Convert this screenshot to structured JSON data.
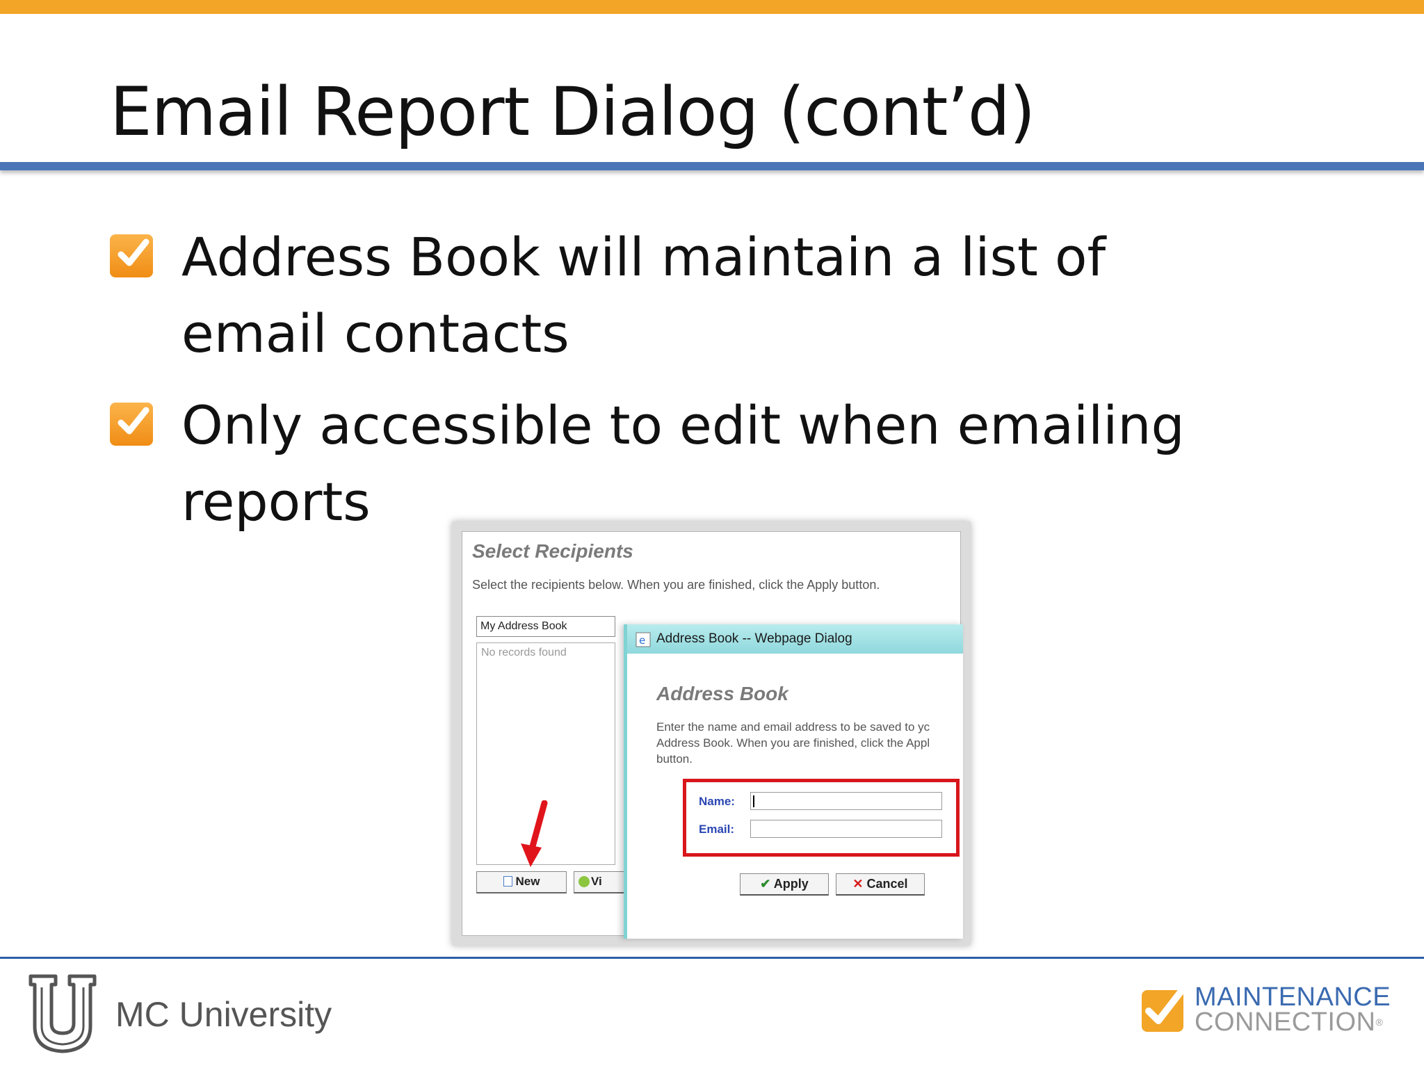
{
  "slide": {
    "title": "Email Report Dialog (cont’d)",
    "bullets": [
      {
        "text": "Address Book will maintain a list of email contacts"
      },
      {
        "text": "Only accessible to edit when emailing reports"
      }
    ]
  },
  "screenshot": {
    "select_recipients": {
      "title": "Select Recipients",
      "description": "Select the recipients below. When you are finished, click the Apply button.",
      "address_book_select": "My Address Book",
      "empty_text": "No records found",
      "new_button": "New",
      "view_button_partial": "Vi"
    },
    "address_book_dialog": {
      "titlebar": "Address Book -- Webpage Dialog",
      "heading": "Address Book",
      "description": "Enter the name and email address to be saved to yc Address Book. When you are finished, click the Appl button.",
      "name_label": "Name:",
      "email_label": "Email:",
      "name_value": "",
      "email_value": "",
      "apply_button": "Apply",
      "cancel_button": "Cancel"
    }
  },
  "footer": {
    "left_text": "MC University",
    "brand_line1": "MAINTENANCE",
    "brand_line2": "CONNECTION"
  },
  "colors": {
    "accent_orange": "#f2a526",
    "title_rule_blue": "#4a76b7",
    "highlight_red": "#d8161c",
    "dialog_teal": "#8fd8dc"
  },
  "icons": [
    "checkbox-checked-icon",
    "document-icon",
    "ie-icon",
    "checkmark-icon",
    "x-icon",
    "red-arrow-icon",
    "u-shield-logo",
    "mc-check-logo"
  ]
}
